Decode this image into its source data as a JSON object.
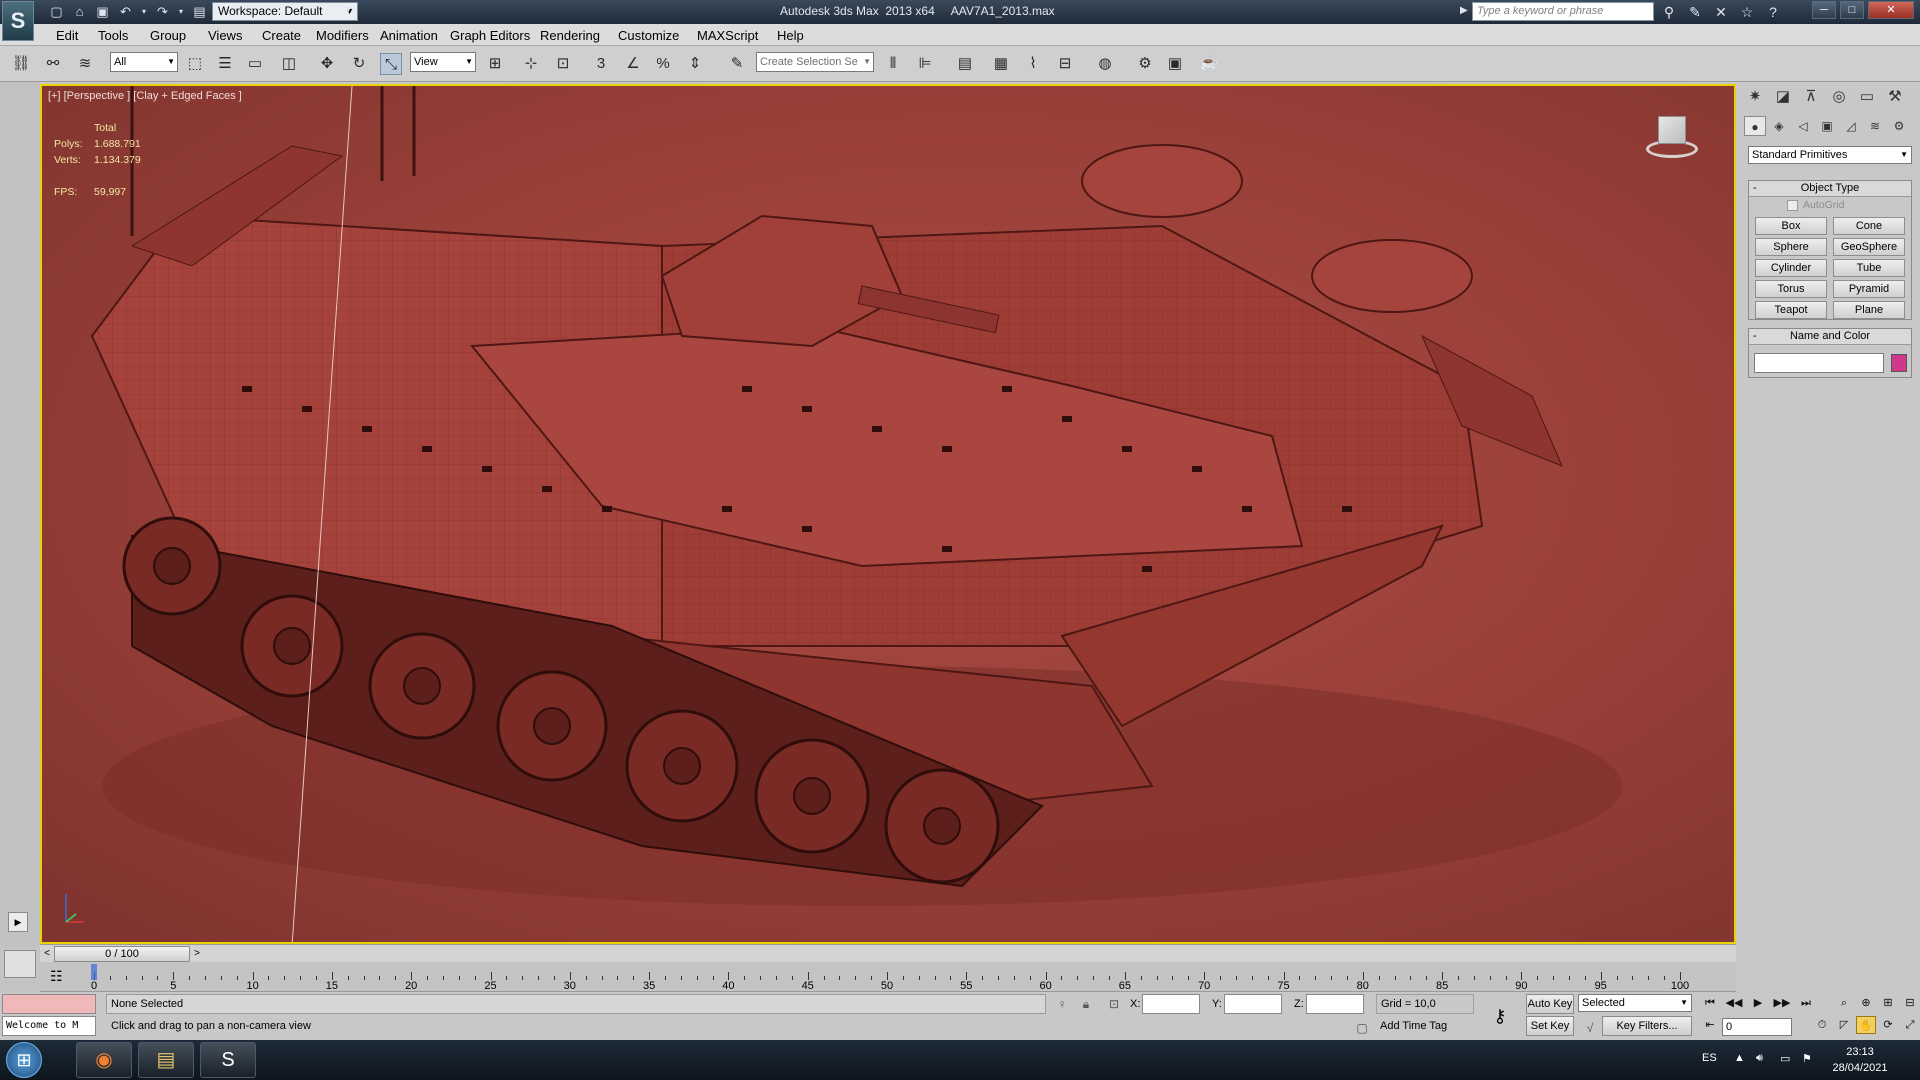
{
  "titlebar": {
    "workspace": "Workspace: Default",
    "app_title": "Autodesk 3ds Max  2013 x64",
    "file_name": "AAV7A1_2013.max",
    "search_placeholder": "Type a keyword or phrase"
  },
  "menu": [
    "Edit",
    "Tools",
    "Group",
    "Views",
    "Create",
    "Modifiers",
    "Animation",
    "Graph Editors",
    "Rendering",
    "Customize",
    "MAXScript",
    "Help"
  ],
  "toolbar": {
    "selection_filter": "All",
    "ref_coord": "View",
    "named_selection_placeholder": "Create Selection Se",
    "snap_label": "3"
  },
  "viewport": {
    "label": "[+] [Perspective ] [Clay + Edged Faces ]",
    "stats": {
      "total_label": "Total",
      "polys_label": "Polys:",
      "polys_value": "1.688.791",
      "verts_label": "Verts:",
      "verts_value": "1.134.379",
      "fps_label": "FPS:",
      "fps_value": "59,997"
    },
    "background_color": "#a0463f",
    "border_color": "#e8d200"
  },
  "command_panel": {
    "category": "Standard Primitives",
    "object_type_title": "Object Type",
    "autogrid": "AutoGrid",
    "buttons": [
      "Box",
      "Cone",
      "Sphere",
      "GeoSphere",
      "Cylinder",
      "Tube",
      "Torus",
      "Pyramid",
      "Teapot",
      "Plane"
    ],
    "name_color_title": "Name and Color",
    "object_color": "#d0388c"
  },
  "timeline": {
    "frame_display": "0 / 100",
    "ticks": [
      "0",
      "5",
      "10",
      "15",
      "20",
      "25",
      "30",
      "35",
      "40",
      "45",
      "50",
      "55",
      "60",
      "65",
      "70",
      "75",
      "80",
      "85",
      "90",
      "95",
      "100"
    ]
  },
  "status": {
    "welcome": "Welcome to M",
    "selection": "None Selected",
    "prompt": "Click and drag to pan a non-camera view",
    "x_label": "X:",
    "y_label": "Y:",
    "z_label": "Z:",
    "grid": "Grid = 10,0",
    "add_time_tag": "Add Time Tag",
    "auto_key": "Auto Key",
    "set_key": "Set Key",
    "selected": "Selected",
    "key_filters": "Key Filters...",
    "current_frame": "0"
  },
  "taskbar": {
    "language": "ES",
    "time": "23:13",
    "date": "28/04/2021"
  }
}
